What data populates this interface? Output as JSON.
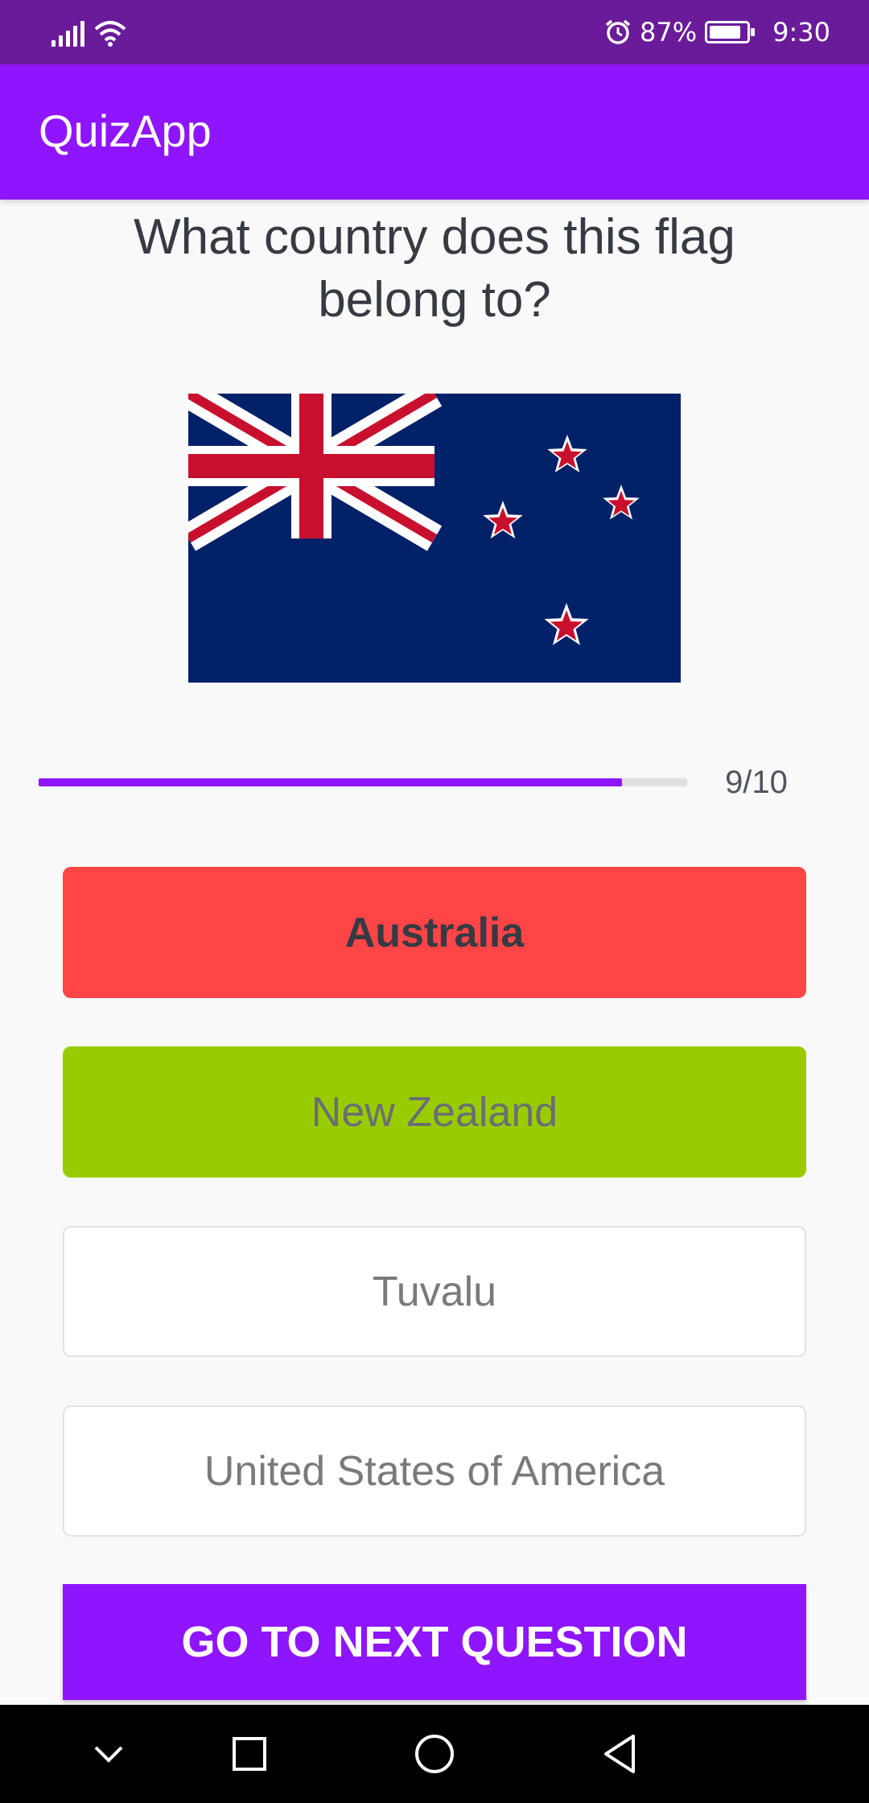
{
  "status_bar": {
    "battery_percent_text": "87%",
    "battery_level": 0.87,
    "time": "9:30",
    "icons": [
      "signal-icon",
      "wifi-icon",
      "alarm-icon",
      "battery-charging-icon"
    ]
  },
  "app_bar": {
    "title": "QuizApp"
  },
  "question": {
    "text": "What country does this flag belong to?",
    "flag_image": "new-zealand-flag"
  },
  "progress": {
    "current": 9,
    "total": 10,
    "label": "9/10",
    "fraction": 0.9
  },
  "options": [
    {
      "label": "Australia",
      "state": "wrong-selected",
      "color": "#ff4545"
    },
    {
      "label": "New Zealand",
      "state": "correct",
      "color": "#99cc00"
    },
    {
      "label": "Tuvalu",
      "state": "default",
      "color": "#ffffff"
    },
    {
      "label": "United States of America",
      "state": "default",
      "color": "#ffffff"
    }
  ],
  "next_button": {
    "label": "GO TO NEXT QUESTION"
  },
  "nav_bar": {
    "icons": [
      "collapse-icon",
      "recents-icon",
      "home-icon",
      "back-icon"
    ]
  },
  "colors": {
    "status_bar": "#6a1b9a",
    "accent": "#8f15fe",
    "wrong": "#ff4545",
    "correct": "#99cc00",
    "text": "#363a43"
  }
}
